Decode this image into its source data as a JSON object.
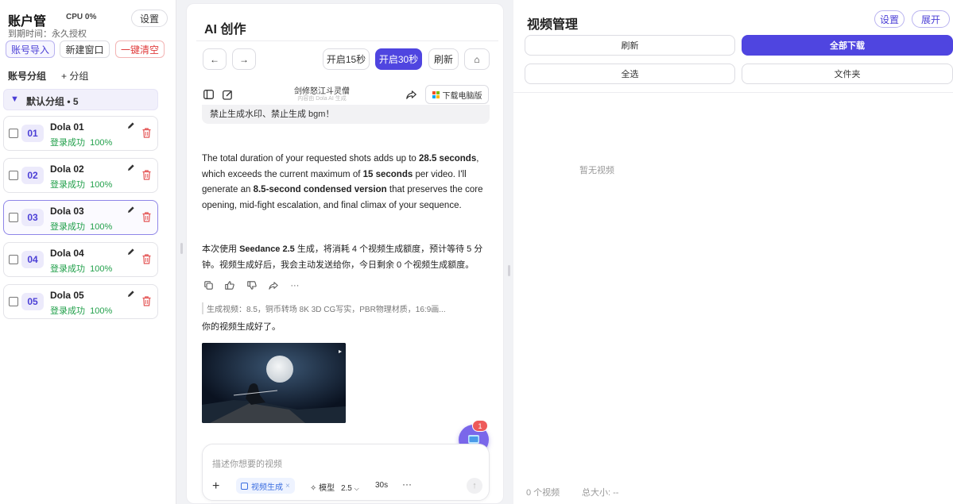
{
  "left": {
    "title": "账户管",
    "cpu": "CPU 0%",
    "settings_label": "设置",
    "expiry": "到期时间：永久授权",
    "buttons": {
      "import": "账号导入",
      "new_window": "新建窗口",
      "clear": "一键清空"
    },
    "group_label": "账号分组",
    "add_group": "+ 分组",
    "group": {
      "name": "默认分组 • 5"
    },
    "accounts": [
      {
        "num": "01",
        "name": "Dola 01",
        "status": "登录成功",
        "percent": "100%"
      },
      {
        "num": "02",
        "name": "Dola 02",
        "status": "登录成功",
        "percent": "100%"
      },
      {
        "num": "03",
        "name": "Dola 03",
        "status": "登录成功",
        "percent": "100%"
      },
      {
        "num": "04",
        "name": "Dola 04",
        "status": "登录成功",
        "percent": "100%"
      },
      {
        "num": "05",
        "name": "Dola 05",
        "status": "登录成功",
        "percent": "100%"
      }
    ]
  },
  "mid": {
    "title": "AI 创作",
    "nav": {
      "back": "←",
      "forward": "→",
      "open15": "开启15秒",
      "open30": "开启30秒",
      "refresh": "刷新",
      "home": "⌂"
    },
    "chat_title": "剑修怒江斗灵僧",
    "chat_subtitle": "内容由 Dola AI 生成",
    "download_desktop": "下载电脑版",
    "prompt_tail": "禁止生成水印、禁止生成 bgm！",
    "reply_en": {
      "p1": "The total duration of your requested shots adds up to ",
      "b1": "28.5 seconds",
      "p2": ", which exceeds the current maximum of ",
      "b2": "15 seconds",
      "p3": " per video. I'll generate an ",
      "b3": "8.5-second condensed version",
      "p4": " that preserves the core opening, mid-fight escalation, and final climax of your sequence."
    },
    "reply_cn": {
      "p1": "本次使用 ",
      "b1": "Seedance 2.5",
      "p2": " 生成，将消耗 4 个视频生成额度，预计等待 5 分钟。视频生成好后，我会主动发送给你，今日剩余 0 个视频生成额度。"
    },
    "gen_note": "生成视频：8.5，铜币转场 8K 3D CG写实，PBR物理材质，16:9画...",
    "done": "你的视频生成好了。",
    "fab_badge": "1",
    "input": {
      "placeholder": "描述你想要的视频",
      "chip": "视频生成",
      "model_label": "模型",
      "model_version": "2.5",
      "duration": "30s",
      "more": "···"
    }
  },
  "right": {
    "title": "视频管理",
    "settings_label": "设置",
    "expand_label": "展开",
    "refresh": "刷新",
    "download_all": "全部下载",
    "select_all": "全选",
    "folder": "文件夹",
    "empty": "暂无视频",
    "count": "0 个视频",
    "total_size": "总大小: --"
  },
  "colors": {
    "accent": "#4f45e0",
    "success": "#22a04b",
    "danger": "#e03c3c"
  }
}
